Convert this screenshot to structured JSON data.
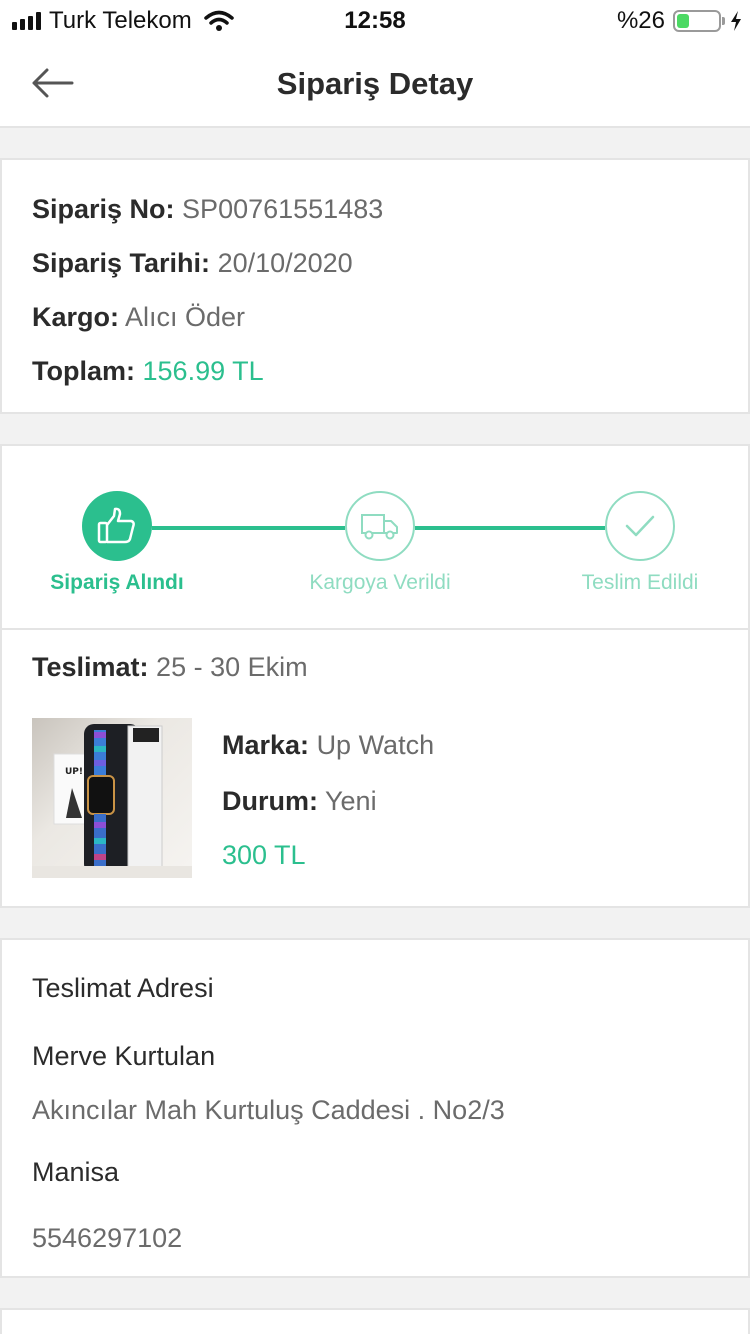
{
  "status_bar": {
    "carrier": "Turk Telekom",
    "time": "12:58",
    "battery_percent": "%26",
    "battery_level": 0.26
  },
  "header": {
    "title": "Sipariş Detay",
    "back_icon": "arrow-left-icon"
  },
  "order": {
    "number_label": "Sipariş No:",
    "number": "SP00761551483",
    "date_label": "Sipariş Tarihi:",
    "date": "20/10/2020",
    "shipping_label": "Kargo:",
    "shipping": "Alıcı Öder",
    "total_label": "Toplam:",
    "total": "156.99 TL"
  },
  "tracking": {
    "steps": [
      {
        "label": "Sipariş Alındı",
        "icon": "thumbs-up-icon",
        "status": "done"
      },
      {
        "label": "Kargoya Verildi",
        "icon": "truck-icon",
        "status": "pending"
      },
      {
        "label": "Teslim Edildi",
        "icon": "check-icon",
        "status": "pending"
      }
    ],
    "accent_color": "#2bbf8e",
    "pending_color": "#8fdcc1"
  },
  "delivery": {
    "label": "Teslimat:",
    "value": "25 - 30 Ekim"
  },
  "product": {
    "brand_label": "Marka:",
    "brand": "Up Watch",
    "condition_label": "Durum:",
    "condition": "Yeni",
    "price": "300 TL",
    "image_logo": "UP!"
  },
  "address": {
    "title": "Teslimat Adresi",
    "name": "Merve Kurtulan",
    "street": "Akıncılar Mah Kurtuluş Caddesi . No2/3",
    "city": "Manisa",
    "phone": "5546297102"
  }
}
